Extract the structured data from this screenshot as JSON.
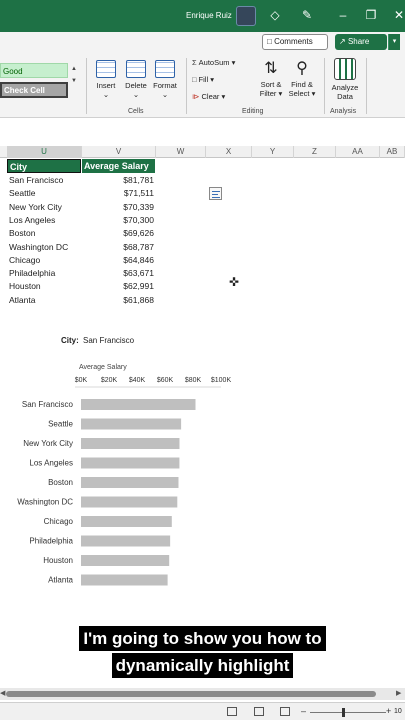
{
  "titlebar": {
    "user": "Enrique Ruiz",
    "icons": [
      "avatar-icon",
      "diamond-icon",
      "pen-icon",
      "minimize-icon",
      "restore-icon",
      "close-icon"
    ]
  },
  "ribbon": {
    "comments_label": "Comments",
    "share_label": "Share",
    "styles": {
      "good": "Good",
      "check_cell": "Check Cell"
    },
    "cells": {
      "insert": "Insert",
      "delete": "Delete",
      "format": "Format",
      "group_label": "Cells"
    },
    "editing": {
      "autosum": "AutoSum",
      "fill": "Fill",
      "clear": "Clear",
      "sort_filter": [
        "Sort &",
        "Filter"
      ],
      "find_select": [
        "Find &",
        "Select"
      ],
      "group_label": "Editing"
    },
    "analysis": {
      "analyze_data": [
        "Analyze",
        "Data"
      ],
      "group_label": "Analysis"
    }
  },
  "sheet": {
    "columns": [
      "U",
      "V",
      "W",
      "X",
      "Y",
      "Z",
      "AA",
      "AB"
    ],
    "selected_column": "U",
    "headers": {
      "city": "City",
      "salary": "Average Salary"
    },
    "rows": [
      {
        "city": "San Francisco",
        "salary": "$81,781"
      },
      {
        "city": "Seattle",
        "salary": "$71,511"
      },
      {
        "city": "New York City",
        "salary": "$70,339"
      },
      {
        "city": "Los Angeles",
        "salary": "$70,300"
      },
      {
        "city": "Boston",
        "salary": "$69,626"
      },
      {
        "city": "Washington DC",
        "salary": "$68,787"
      },
      {
        "city": "Chicago",
        "salary": "$64,846"
      },
      {
        "city": "Philadelphia",
        "salary": "$63,671"
      },
      {
        "city": "Houston",
        "salary": "$62,991"
      },
      {
        "city": "Atlanta",
        "salary": "$61,868"
      }
    ]
  },
  "selector": {
    "label": "City:",
    "value": "San Francisco"
  },
  "chart_data": {
    "type": "bar",
    "orientation": "horizontal",
    "title": "Average Salary",
    "categories": [
      "San Francisco",
      "Seattle",
      "New York City",
      "Los Angeles",
      "Boston",
      "Washington DC",
      "Chicago",
      "Philadelphia",
      "Houston",
      "Atlanta"
    ],
    "values": [
      81781,
      71511,
      70339,
      70300,
      69626,
      68787,
      64846,
      63671,
      62991,
      61868
    ],
    "xlim": [
      0,
      100000
    ],
    "x_ticks": [
      "$0K",
      "$20K",
      "$40K",
      "$60K",
      "$80K",
      "$100K"
    ],
    "bar_color": "#bfbfbf",
    "legend": "none",
    "grid": false
  },
  "caption": {
    "line1": "I'm going to show you how to",
    "line2": "dynamically highlight"
  },
  "status": {
    "zoom": "10"
  }
}
